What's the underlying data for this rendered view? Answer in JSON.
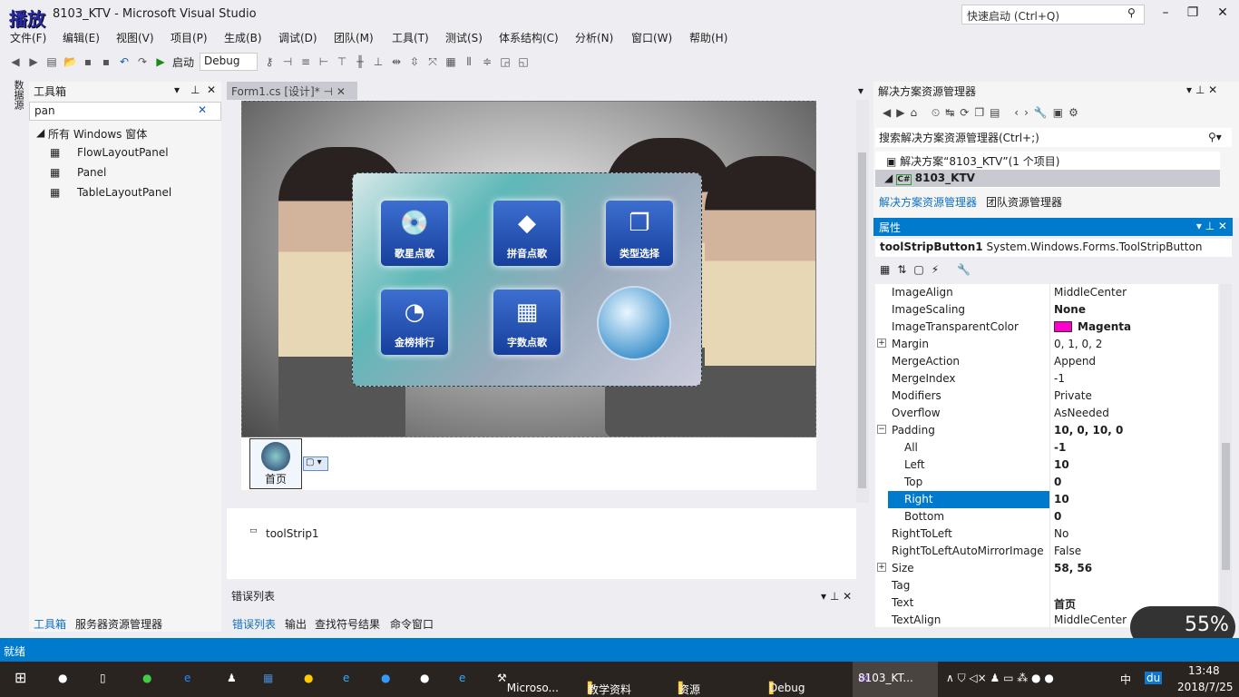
{
  "window": {
    "logo_text": "播放",
    "title": "8103_KTV - Microsoft Visual Studio",
    "quick_launch": "快速启动 (Ctrl+Q)"
  },
  "menu": [
    "文件(F)",
    "编辑(E)",
    "视图(V)",
    "项目(P)",
    "生成(B)",
    "调试(D)",
    "团队(M)",
    "工具(T)",
    "测试(S)",
    "体系结构(C)",
    "分析(N)",
    "窗口(W)",
    "帮助(H)"
  ],
  "toolbar": {
    "start": "启动",
    "config": "Debug"
  },
  "side_tab": "数据源",
  "toolbox": {
    "title": "工具箱",
    "search": "pan",
    "group": "所有 Windows 窗体",
    "items": [
      "FlowLayoutPanel",
      "Panel",
      "TableLayoutPanel"
    ],
    "tabs": [
      "工具箱",
      "服务器资源管理器"
    ]
  },
  "document": {
    "tab": "Form1.cs [设计]*",
    "menu_items": [
      "歌星点歌",
      "拼音点歌",
      "类型选择",
      "金榜排行",
      "字数点歌"
    ],
    "home_button": "首页",
    "component": "toolStrip1"
  },
  "bottom": {
    "title": "错误列表",
    "tabs": [
      "错误列表",
      "输出",
      "查找符号结果",
      "命令窗口"
    ]
  },
  "solution_explorer": {
    "title": "解决方案资源管理器",
    "search": "搜索解决方案资源管理器(Ctrl+;)",
    "solution": "解决方案“8103_KTV”(1 个项目)",
    "project": "8103_KTV",
    "tabs": [
      "解决方案资源管理器",
      "团队资源管理器"
    ]
  },
  "properties": {
    "title": "属性",
    "object": "toolStripButton1",
    "type": "System.Windows.Forms.ToolStripButton",
    "rows": [
      {
        "name": "ImageAlign",
        "value": "MiddleCenter"
      },
      {
        "name": "ImageScaling",
        "value": "None",
        "bold": true
      },
      {
        "name": "ImageTransparentColor",
        "value": "Magenta",
        "bold": true,
        "swatch": "#ff00cc"
      },
      {
        "name": "Margin",
        "value": "0, 1, 0, 2",
        "expand": "+"
      },
      {
        "name": "MergeAction",
        "value": "Append"
      },
      {
        "name": "MergeIndex",
        "value": "-1"
      },
      {
        "name": "Modifiers",
        "value": "Private"
      },
      {
        "name": "Overflow",
        "value": "AsNeeded"
      },
      {
        "name": "Padding",
        "value": "10, 0, 10, 0",
        "bold": true,
        "expand": "−"
      },
      {
        "name": "All",
        "value": "-1",
        "bold": true,
        "child": true
      },
      {
        "name": "Left",
        "value": "10",
        "bold": true,
        "child": true
      },
      {
        "name": "Top",
        "value": "0",
        "bold": true,
        "child": true
      },
      {
        "name": "Right",
        "value": "10",
        "bold": true,
        "child": true,
        "selected": true
      },
      {
        "name": "Bottom",
        "value": "0",
        "bold": true,
        "child": true
      },
      {
        "name": "RightToLeft",
        "value": "No"
      },
      {
        "name": "RightToLeftAutoMirrorImage",
        "value": "False"
      },
      {
        "name": "Size",
        "value": "58, 56",
        "bold": true,
        "expand": "+"
      },
      {
        "name": "Tag",
        "value": ""
      },
      {
        "name": "Text",
        "value": "首页",
        "bold": true
      },
      {
        "name": "TextAlign",
        "value": "MiddleCenter"
      }
    ]
  },
  "status": "就绪",
  "network_widget": {
    "percent": "55%"
  },
  "taskbar": {
    "items": [
      "Microso...",
      "教学资料",
      "资源",
      "Debug",
      "8103_KT..."
    ],
    "ime": "中",
    "time": "13:48",
    "date": "2018/7/25"
  },
  "colors": {
    "accent": "#007acc",
    "taskbar": "#2a2420"
  }
}
